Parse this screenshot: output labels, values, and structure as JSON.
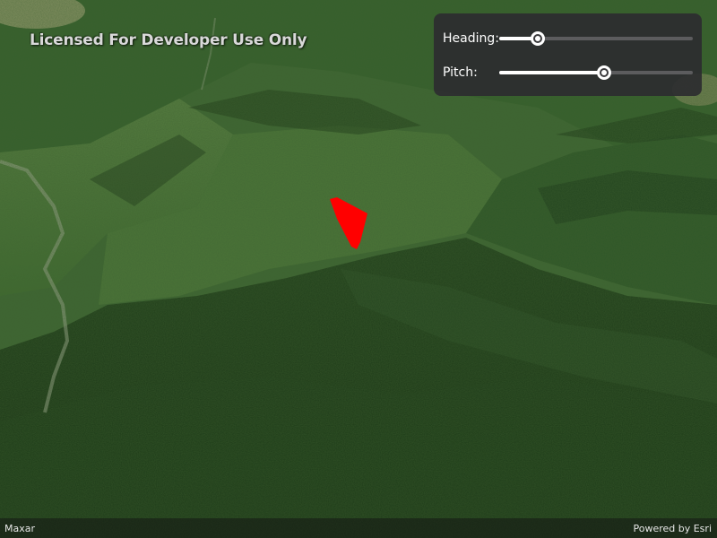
{
  "map": {
    "watermark": "Licensed For Developer Use Only",
    "graphic_color": "#ff0000"
  },
  "controls": {
    "heading": {
      "label": "Heading:",
      "value_fraction": 0.2
    },
    "pitch": {
      "label": "Pitch:",
      "value_fraction": 0.54
    }
  },
  "attribution": {
    "source": "Maxar",
    "powered_by": "Powered by Esri"
  }
}
